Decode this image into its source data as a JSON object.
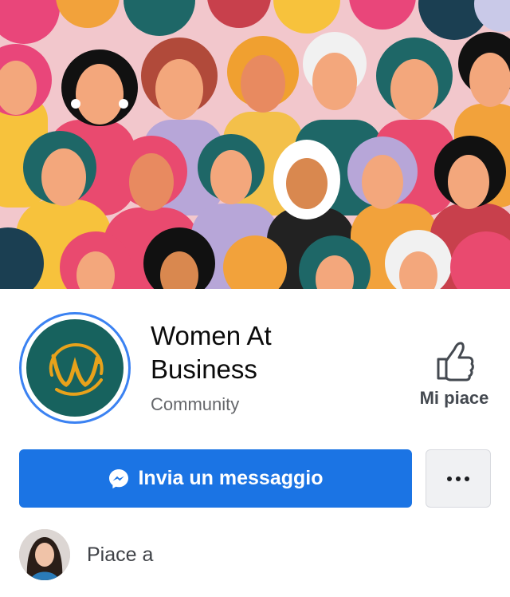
{
  "page": {
    "name": "Women At Business",
    "name_line1": "Women At",
    "name_line2": "Business",
    "category": "Community"
  },
  "actions": {
    "like_label": "Mi piace",
    "message_label": "Invia un messaggio"
  },
  "liked_by": {
    "label": "Piace a"
  },
  "icons": {
    "cover": "cover-photo-crowd-of-women",
    "profile": "women-at-business-logo",
    "like": "thumbs-up-icon",
    "message": "messenger-icon",
    "more": "more-dots-icon",
    "avatar": "user-avatar"
  },
  "colors": {
    "primary_button": "#1b74e4",
    "logo_background": "#17625e",
    "logo_mark": "#e8a21b",
    "profile_ring": "#3b82f2",
    "secondary_button": "#f0f1f3"
  }
}
